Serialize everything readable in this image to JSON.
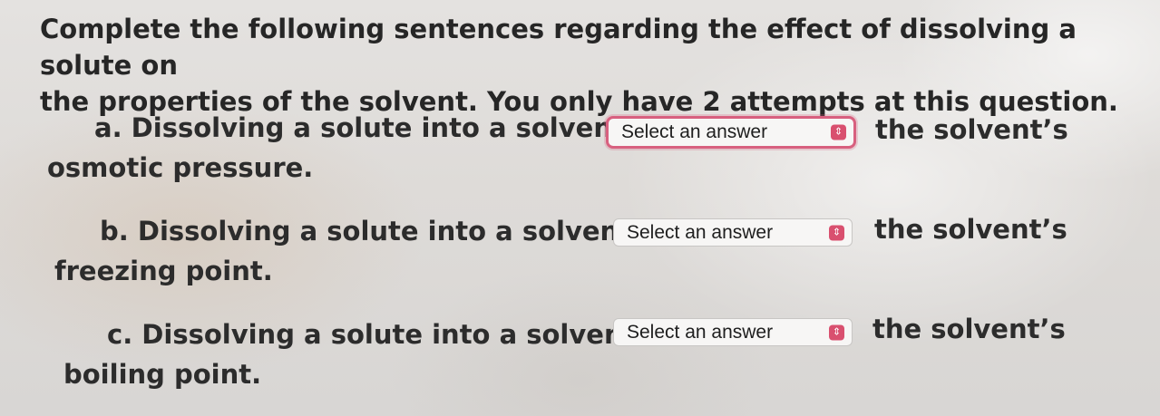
{
  "question": {
    "line1": "Complete the following sentences regarding the effect of dissolving a solute on",
    "line2": "the properties of the solvent. You only have 2 attempts at this question."
  },
  "items": [
    {
      "prefix": "a. Dissolving a solute into a solvent",
      "select_placeholder": "Select an answer",
      "suffix": "the solvent’s",
      "continuation": "osmotic pressure."
    },
    {
      "prefix": "b. Dissolving a solute into a solvent",
      "select_placeholder": "Select an answer",
      "suffix": "the solvent’s",
      "continuation": "freezing point."
    },
    {
      "prefix": "c. Dissolving a solute into a solvent",
      "select_placeholder": "Select an answer",
      "suffix": "the solvent’s",
      "continuation": "boiling point."
    }
  ],
  "icons": {
    "select_chevron": "up-down-chevron-icon"
  },
  "colors": {
    "accent": "#d9506f",
    "focus_ring": "#d8607f",
    "text": "#2a2a2a"
  }
}
